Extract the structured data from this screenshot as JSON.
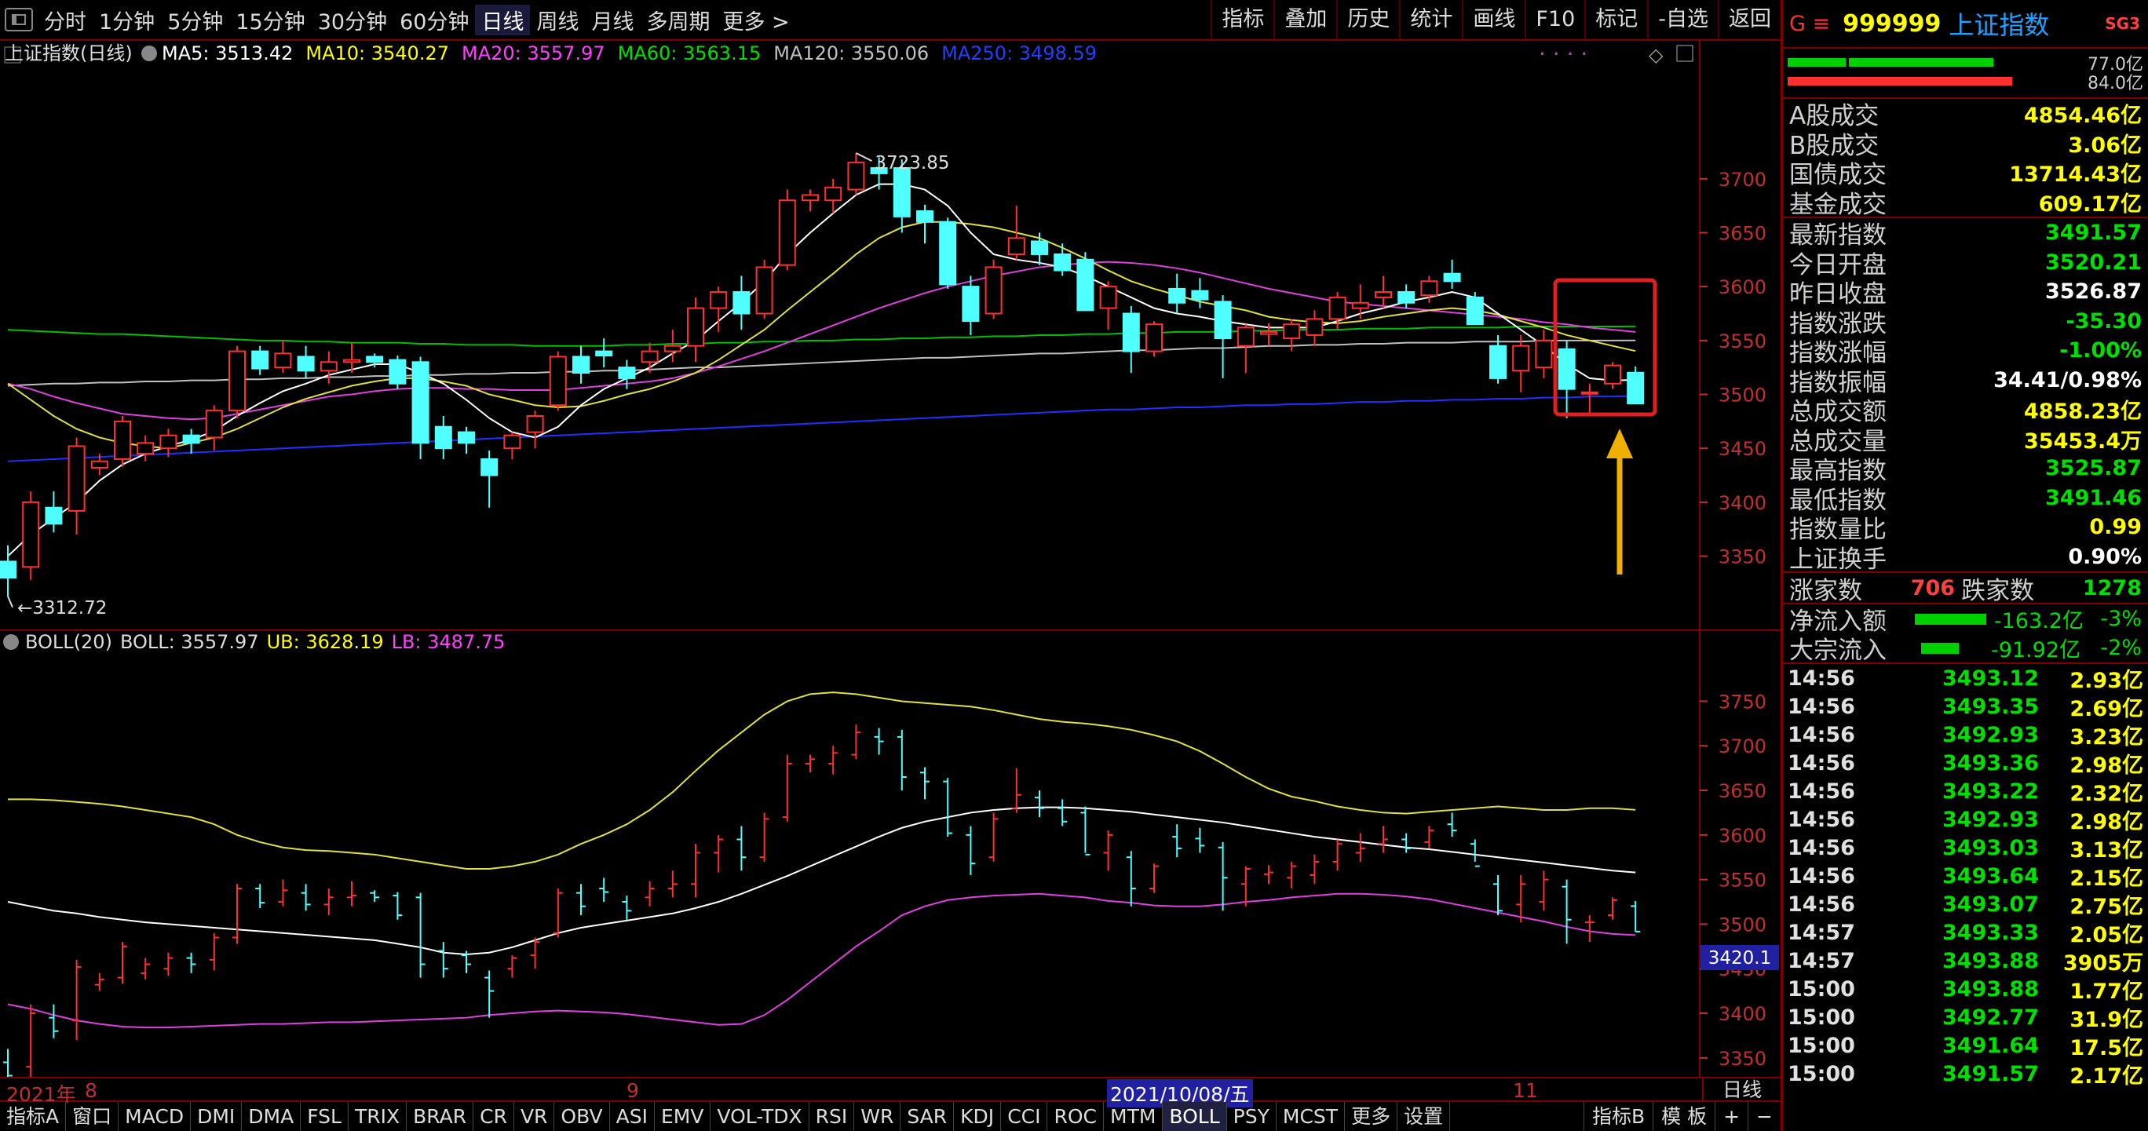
{
  "toolbar": {
    "periods": [
      "分时",
      "1分钟",
      "5分钟",
      "15分钟",
      "30分钟",
      "60分钟",
      "日线",
      "周线",
      "月线",
      "多周期",
      "更多 >"
    ],
    "active": "日线",
    "right": [
      "指标",
      "叠加",
      "历史",
      "统计",
      "画线",
      "F10",
      "标记",
      "-自选",
      "返回"
    ]
  },
  "main_header": {
    "title": "上证指数(日线)",
    "ma": [
      {
        "label": "MA5: 3513.42",
        "color": "#ffffff"
      },
      {
        "label": "MA10: 3540.27",
        "color": "#ffff00"
      },
      {
        "label": "MA20: 3557.97",
        "color": "#ff40ff"
      },
      {
        "label": "MA60: 3563.15",
        "color": "#00e000"
      },
      {
        "label": "MA120: 3550.06",
        "color": "#c0c0c0"
      },
      {
        "label": "MA250: 3498.59",
        "color": "#2040ff"
      }
    ],
    "high_label": "3723.85",
    "low_label": "3312.72"
  },
  "boll_header": {
    "title": "BOLL(20)",
    "boll": "BOLL: 3557.97",
    "ub": "UB: 3628.19",
    "lb": "LB: 3487.75",
    "cursor_value": "3420.1"
  },
  "date_axis": {
    "labels": [
      "2021年",
      "8",
      "9",
      "2021/10/08/五",
      "11"
    ],
    "mode": "日线"
  },
  "tabs": {
    "items": [
      "指标A",
      "窗口",
      "MACD",
      "DMI",
      "DMA",
      "FSL",
      "TRIX",
      "BRAR",
      "CR",
      "VR",
      "OBV",
      "ASI",
      "EMV",
      "VOL-TDX",
      "RSI",
      "WR",
      "SAR",
      "KDJ",
      "CCI",
      "ROC",
      "MTM",
      "BOLL",
      "PSY",
      "MCST",
      "更多",
      "设置"
    ],
    "active": "BOLL",
    "right": [
      "指标B",
      "模 板",
      "+",
      "−"
    ]
  },
  "panel": {
    "title": {
      "g": "G ≡",
      "code": "999999",
      "name": "上证指数",
      "tag": "SG3"
    },
    "bars": [
      {
        "value": "77.0亿",
        "color": "#00d000",
        "fraction": 0.77
      },
      {
        "value": "84.0亿",
        "color": "#ff3030",
        "fraction": 0.84
      }
    ],
    "volumes": [
      {
        "label": "A股成交",
        "value": "4854.46亿"
      },
      {
        "label": "B股成交",
        "value": "3.06亿"
      },
      {
        "label": "国债成交",
        "value": "13714.43亿"
      },
      {
        "label": "基金成交",
        "value": "609.17亿"
      }
    ],
    "stats": [
      {
        "label": "最新指数",
        "value": "3491.57",
        "color": "#00e000"
      },
      {
        "label": "今日开盘",
        "value": "3520.21",
        "color": "#00e000"
      },
      {
        "label": "昨日收盘",
        "value": "3526.87",
        "color": "#ffffff"
      },
      {
        "label": "指数涨跌",
        "value": "-35.30",
        "color": "#00e000"
      },
      {
        "label": "指数涨幅",
        "value": "-1.00%",
        "color": "#00e000"
      },
      {
        "label": "指数振幅",
        "value": "34.41/0.98%",
        "color": "#ffffff"
      },
      {
        "label": "总成交额",
        "value": "4858.23亿",
        "color": "#ffff00"
      },
      {
        "label": "总成交量",
        "value": "35453.4万",
        "color": "#ffff00"
      },
      {
        "label": "最高指数",
        "value": "3525.87",
        "color": "#00e000"
      },
      {
        "label": "最低指数",
        "value": "3491.46",
        "color": "#00e000"
      },
      {
        "label": "指数量比",
        "value": "0.99",
        "color": "#ffff00"
      },
      {
        "label": "上证换手",
        "value": "0.90%",
        "color": "#ffffff"
      }
    ],
    "updown": {
      "up_label": "涨家数",
      "up": "706",
      "down_label": "跌家数",
      "down": "1278"
    },
    "flows": [
      {
        "label": "净流入额",
        "value": "-163.2亿",
        "pct": "-3%",
        "fraction": 0.6
      },
      {
        "label": "大宗流入",
        "value": "-91.92亿",
        "pct": "-2%",
        "fraction": 0.3
      }
    ],
    "ticks": [
      [
        "14:56",
        "3493.12",
        "2.93亿"
      ],
      [
        "14:56",
        "3493.35",
        "2.69亿"
      ],
      [
        "14:56",
        "3492.93",
        "3.23亿"
      ],
      [
        "14:56",
        "3493.36",
        "2.98亿"
      ],
      [
        "14:56",
        "3493.22",
        "2.32亿"
      ],
      [
        "14:56",
        "3492.93",
        "2.98亿"
      ],
      [
        "14:56",
        "3493.03",
        "3.13亿"
      ],
      [
        "14:56",
        "3493.64",
        "2.15亿"
      ],
      [
        "14:56",
        "3493.07",
        "2.75亿"
      ],
      [
        "14:57",
        "3493.33",
        "2.05亿"
      ],
      [
        "14:57",
        "3493.88",
        "3905万"
      ],
      [
        "15:00",
        "3493.88",
        "1.77亿"
      ],
      [
        "15:00",
        "3492.77",
        "31.9亿"
      ],
      [
        "15:00",
        "3491.64",
        "17.5亿"
      ],
      [
        "15:00",
        "3491.57",
        "2.17亿"
      ]
    ]
  },
  "chart_data": {
    "type": "candlestick",
    "main_axis": {
      "ylim": [
        3292.9,
        3784.3
      ],
      "ticks": [
        3350,
        3400,
        3450,
        3500,
        3550,
        3600,
        3650,
        3700
      ]
    },
    "boll_axis": {
      "ylim": [
        3337.5,
        3804.1
      ],
      "ticks": [
        3350,
        3400,
        3450,
        3500,
        3550,
        3600,
        3650,
        3700,
        3750
      ]
    },
    "candles": [
      [
        3345,
        3360,
        3312.72,
        3330
      ],
      [
        3340,
        3410,
        3328,
        3400
      ],
      [
        3395,
        3410,
        3372,
        3380
      ],
      [
        3392,
        3460,
        3370,
        3452
      ],
      [
        3432,
        3445,
        3425,
        3438
      ],
      [
        3440,
        3480,
        3433,
        3475
      ],
      [
        3445,
        3462,
        3438,
        3455
      ],
      [
        3450,
        3468,
        3442,
        3462
      ],
      [
        3462,
        3468,
        3445,
        3455
      ],
      [
        3460,
        3490,
        3448,
        3485
      ],
      [
        3485,
        3545,
        3478,
        3540
      ],
      [
        3540,
        3545,
        3518,
        3524
      ],
      [
        3525,
        3550,
        3520,
        3538
      ],
      [
        3535,
        3545,
        3515,
        3522
      ],
      [
        3522,
        3540,
        3510,
        3530
      ],
      [
        3530,
        3548,
        3520,
        3532
      ],
      [
        3535,
        3538,
        3525,
        3530
      ],
      [
        3532,
        3536,
        3505,
        3510
      ],
      [
        3530,
        3535,
        3440,
        3455
      ],
      [
        3470,
        3480,
        3440,
        3450
      ],
      [
        3465,
        3470,
        3445,
        3455
      ],
      [
        3440,
        3448,
        3395,
        3425
      ],
      [
        3450,
        3465,
        3440,
        3462
      ],
      [
        3465,
        3485,
        3450,
        3480
      ],
      [
        3490,
        3540,
        3485,
        3535
      ],
      [
        3535,
        3545,
        3510,
        3520
      ],
      [
        3540,
        3552,
        3525,
        3536
      ],
      [
        3525,
        3532,
        3505,
        3515
      ],
      [
        3530,
        3548,
        3520,
        3540
      ],
      [
        3540,
        3560,
        3530,
        3545
      ],
      [
        3545,
        3590,
        3530,
        3580
      ],
      [
        3580,
        3600,
        3558,
        3595
      ],
      [
        3595,
        3610,
        3560,
        3575
      ],
      [
        3575,
        3625,
        3570,
        3618
      ],
      [
        3620,
        3690,
        3615,
        3680
      ],
      [
        3680,
        3690,
        3670,
        3685
      ],
      [
        3680,
        3700,
        3668,
        3692
      ],
      [
        3690,
        3723.85,
        3685,
        3715
      ],
      [
        3710,
        3720,
        3690,
        3705
      ],
      [
        3710,
        3718,
        3650,
        3665
      ],
      [
        3670,
        3676,
        3640,
        3660
      ],
      [
        3660,
        3664,
        3598,
        3602
      ],
      [
        3600,
        3610,
        3555,
        3568
      ],
      [
        3575,
        3625,
        3570,
        3618
      ],
      [
        3630,
        3675,
        3625,
        3645
      ],
      [
        3642,
        3650,
        3620,
        3630
      ],
      [
        3630,
        3640,
        3610,
        3615
      ],
      [
        3625,
        3632,
        3580,
        3578
      ],
      [
        3580,
        3605,
        3560,
        3600
      ],
      [
        3575,
        3582,
        3520,
        3540
      ],
      [
        3540,
        3568,
        3535,
        3565
      ],
      [
        3598,
        3612,
        3575,
        3585
      ],
      [
        3596,
        3608,
        3580,
        3588
      ],
      [
        3586,
        3592,
        3515,
        3552
      ],
      [
        3545,
        3565,
        3520,
        3562
      ],
      [
        3556,
        3566,
        3545,
        3558
      ],
      [
        3552,
        3570,
        3540,
        3565
      ],
      [
        3555,
        3578,
        3545,
        3570
      ],
      [
        3570,
        3595,
        3560,
        3590
      ],
      [
        3580,
        3602,
        3570,
        3585
      ],
      [
        3590,
        3610,
        3580,
        3595
      ],
      [
        3595,
        3602,
        3580,
        3585
      ],
      [
        3592,
        3610,
        3585,
        3605
      ],
      [
        3612,
        3625,
        3598,
        3605
      ],
      [
        3590,
        3595,
        3570,
        3565
      ],
      [
        3545,
        3555,
        3510,
        3515
      ],
      [
        3522,
        3555,
        3502,
        3545
      ],
      [
        3525,
        3560,
        3515,
        3550
      ],
      [
        3542,
        3550,
        3478,
        3505
      ],
      [
        3502,
        3510,
        3480,
        3502
      ],
      [
        3510,
        3530,
        3505,
        3526.87
      ],
      [
        3520.21,
        3525.87,
        3491.46,
        3491.57
      ]
    ],
    "ma5": [
      3350,
      3370,
      3385,
      3400,
      3420,
      3435,
      3445,
      3452,
      3458,
      3466,
      3480,
      3492,
      3503,
      3510,
      3518,
      3523,
      3528,
      3528,
      3520,
      3510,
      3495,
      3478,
      3465,
      3460,
      3470,
      3490,
      3505,
      3515,
      3525,
      3538,
      3550,
      3568,
      3585,
      3605,
      3630,
      3650,
      3668,
      3685,
      3695,
      3695,
      3690,
      3675,
      3650,
      3630,
      3625,
      3622,
      3618,
      3610,
      3600,
      3590,
      3580,
      3575,
      3572,
      3568,
      3565,
      3562,
      3562,
      3562,
      3568,
      3575,
      3580,
      3586,
      3590,
      3595,
      3590,
      3575,
      3560,
      3545,
      3528,
      3515,
      3513,
      3513.42
    ],
    "ma10": [
      3510,
      3495,
      3480,
      3468,
      3460,
      3455,
      3452,
      3450,
      3455,
      3460,
      3468,
      3478,
      3488,
      3496,
      3502,
      3508,
      3512,
      3515,
      3515,
      3512,
      3508,
      3500,
      3495,
      3490,
      3488,
      3489,
      3494,
      3500,
      3505,
      3512,
      3520,
      3532,
      3546,
      3560,
      3578,
      3595,
      3612,
      3630,
      3645,
      3655,
      3660,
      3660,
      3658,
      3655,
      3650,
      3645,
      3636,
      3626,
      3615,
      3605,
      3598,
      3592,
      3586,
      3582,
      3578,
      3572,
      3569,
      3567,
      3566,
      3568,
      3572,
      3575,
      3578,
      3580,
      3578,
      3574,
      3568,
      3562,
      3555,
      3550,
      3545,
      3540.27
    ],
    "ma20": [
      3510,
      3505,
      3498,
      3492,
      3487,
      3482,
      3480,
      3478,
      3477,
      3478,
      3482,
      3486,
      3490,
      3494,
      3498,
      3500,
      3503,
      3505,
      3506,
      3506,
      3505,
      3505,
      3504,
      3504,
      3504,
      3506,
      3508,
      3510,
      3512,
      3515,
      3520,
      3526,
      3533,
      3540,
      3548,
      3556,
      3564,
      3572,
      3580,
      3587,
      3594,
      3600,
      3605,
      3610,
      3614,
      3618,
      3620,
      3622,
      3623,
      3622,
      3620,
      3617,
      3613,
      3608,
      3603,
      3598,
      3594,
      3590,
      3586,
      3584,
      3582,
      3580,
      3578,
      3576,
      3574,
      3572,
      3570,
      3567,
      3565,
      3562,
      3560,
      3557.97
    ],
    "ma60": [
      3560,
      3559,
      3558,
      3557,
      3556,
      3556,
      3555,
      3554,
      3553,
      3552,
      3551,
      3550,
      3550,
      3549,
      3549,
      3548,
      3548,
      3548,
      3547,
      3547,
      3546,
      3546,
      3546,
      3545,
      3545,
      3545,
      3545,
      3546,
      3546,
      3547,
      3547,
      3548,
      3548,
      3549,
      3549,
      3550,
      3550,
      3551,
      3551,
      3552,
      3552,
      3553,
      3553,
      3554,
      3554,
      3555,
      3555,
      3556,
      3556,
      3557,
      3557,
      3558,
      3558,
      3558,
      3559,
      3559,
      3560,
      3560,
      3560,
      3561,
      3561,
      3561,
      3562,
      3562,
      3562,
      3562,
      3563,
      3563,
      3563,
      3563,
      3563,
      3563.15
    ],
    "ma120": [
      3508,
      3509,
      3510,
      3510,
      3511,
      3511,
      3512,
      3512,
      3513,
      3513,
      3514,
      3514,
      3515,
      3515,
      3516,
      3516,
      3517,
      3517,
      3518,
      3518,
      3519,
      3519,
      3520,
      3520,
      3521,
      3521,
      3522,
      3522,
      3523,
      3524,
      3525,
      3525,
      3526,
      3527,
      3528,
      3529,
      3530,
      3531,
      3532,
      3533,
      3534,
      3534,
      3535,
      3536,
      3537,
      3538,
      3538,
      3539,
      3540,
      3541,
      3541,
      3542,
      3543,
      3543,
      3544,
      3545,
      3545,
      3546,
      3546,
      3547,
      3547,
      3548,
      3548,
      3548,
      3549,
      3549,
      3549,
      3550,
      3550,
      3550,
      3550,
      3550.06
    ],
    "ma250": [
      3438,
      3439,
      3440,
      3441,
      3442,
      3443,
      3444,
      3445,
      3446,
      3447,
      3448,
      3449,
      3450,
      3451,
      3452,
      3453,
      3454,
      3455,
      3456,
      3457,
      3458,
      3459,
      3460,
      3461,
      3462,
      3463,
      3464,
      3465,
      3466,
      3467,
      3468,
      3469,
      3470,
      3471,
      3472,
      3473,
      3474,
      3475,
      3476,
      3477,
      3478,
      3479,
      3480,
      3481,
      3482,
      3483,
      3484,
      3485,
      3486,
      3486,
      3487,
      3488,
      3488,
      3489,
      3490,
      3490,
      3491,
      3491,
      3492,
      3493,
      3493,
      3494,
      3494,
      3495,
      3495,
      3496,
      3496,
      3497,
      3497,
      3498,
      3498,
      3498.59
    ],
    "boll_mid": [
      3525,
      3520,
      3515,
      3512,
      3508,
      3505,
      3502,
      3500,
      3498,
      3496,
      3494,
      3492,
      3490,
      3488,
      3486,
      3484,
      3482,
      3478,
      3474,
      3468,
      3466,
      3468,
      3474,
      3482,
      3490,
      3496,
      3500,
      3504,
      3508,
      3512,
      3518,
      3525,
      3534,
      3544,
      3554,
      3565,
      3576,
      3587,
      3598,
      3608,
      3615,
      3620,
      3625,
      3628,
      3630,
      3631,
      3631,
      3630,
      3628,
      3626,
      3623,
      3620,
      3617,
      3614,
      3610,
      3606,
      3602,
      3598,
      3595,
      3592,
      3589,
      3586,
      3584,
      3581,
      3578,
      3575,
      3572,
      3569,
      3566,
      3563,
      3560,
      3557.97
    ],
    "boll_ub": [
      3640,
      3640,
      3639,
      3637,
      3635,
      3632,
      3628,
      3624,
      3620,
      3612,
      3600,
      3592,
      3586,
      3583,
      3582,
      3580,
      3578,
      3574,
      3570,
      3566,
      3562,
      3562,
      3565,
      3570,
      3578,
      3590,
      3600,
      3612,
      3628,
      3648,
      3672,
      3695,
      3715,
      3735,
      3750,
      3758,
      3760,
      3758,
      3754,
      3750,
      3748,
      3746,
      3744,
      3740,
      3735,
      3730,
      3727,
      3725,
      3722,
      3718,
      3712,
      3705,
      3694,
      3680,
      3665,
      3652,
      3643,
      3638,
      3632,
      3628,
      3625,
      3624,
      3626,
      3628,
      3630,
      3632,
      3630,
      3628,
      3628,
      3630,
      3630,
      3628.19
    ],
    "boll_lb": [
      3410,
      3405,
      3398,
      3392,
      3388,
      3385,
      3384,
      3384,
      3385,
      3386,
      3387,
      3388,
      3388,
      3389,
      3390,
      3390,
      3391,
      3392,
      3393,
      3394,
      3395,
      3398,
      3400,
      3402,
      3403,
      3402,
      3401,
      3399,
      3396,
      3393,
      3390,
      3387,
      3388,
      3398,
      3415,
      3435,
      3455,
      3475,
      3492,
      3510,
      3520,
      3527,
      3530,
      3532,
      3533,
      3534,
      3532,
      3530,
      3526,
      3524,
      3521,
      3520,
      3520,
      3522,
      3525,
      3527,
      3530,
      3532,
      3534,
      3534,
      3533,
      3531,
      3528,
      3523,
      3518,
      3513,
      3508,
      3503,
      3497,
      3492,
      3489,
      3487.75
    ]
  }
}
